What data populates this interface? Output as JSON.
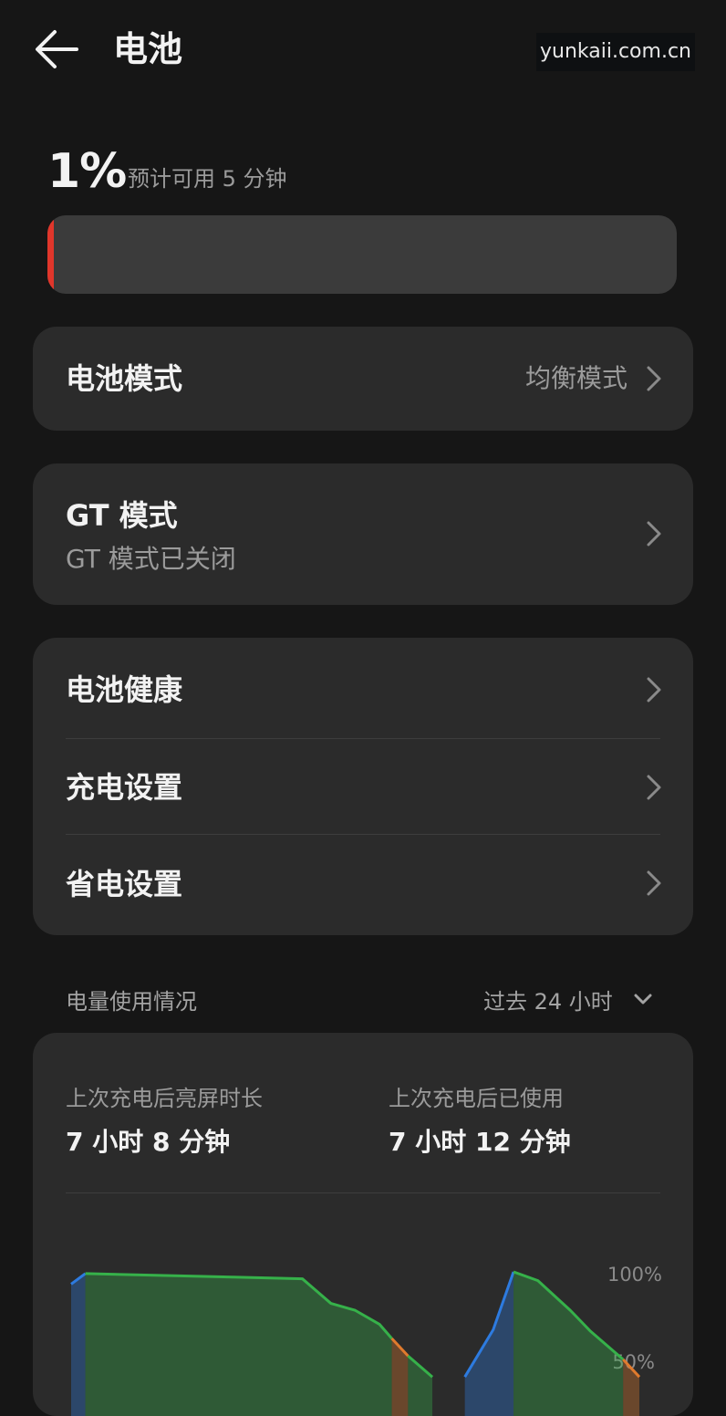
{
  "header": {
    "title": "电池",
    "watermark": "yunkaii.com.cn"
  },
  "battery": {
    "percent": "1%",
    "estimate": "预计可用 5 分钟",
    "level_fraction": 0.01,
    "level_color": "#e0362b"
  },
  "battery_mode": {
    "label": "电池模式",
    "value": "均衡模式"
  },
  "gt_mode": {
    "label": "GT 模式",
    "status": "GT 模式已关闭"
  },
  "settings": [
    {
      "label": "电池健康"
    },
    {
      "label": "充电设置"
    },
    {
      "label": "省电设置"
    }
  ],
  "usage": {
    "title": "电量使用情况",
    "range": "过去 24 小时",
    "stats": [
      {
        "label": "上次充电后亮屏时长",
        "value": "7 小时 8 分钟"
      },
      {
        "label": "上次充电后已使用",
        "value": "7 小时 12 分钟"
      }
    ]
  },
  "chart_data": {
    "type": "area",
    "y_tick_labels": [
      "100%",
      "50%"
    ],
    "ylim": [
      0,
      100
    ],
    "colors": {
      "discharge": "#36b14a",
      "charge": "#2d7be0",
      "warn": "#e07a2d"
    },
    "segments": [
      {
        "kind": "charge",
        "points": [
          [
            0,
            93
          ],
          [
            0.35,
            99
          ]
        ]
      },
      {
        "kind": "discharge",
        "points": [
          [
            0.35,
            99
          ],
          [
            4.0,
            97
          ],
          [
            5.7,
            96
          ],
          [
            5.9,
            92
          ],
          [
            6.4,
            82
          ],
          [
            7.0,
            78
          ],
          [
            7.6,
            70
          ],
          [
            7.9,
            62
          ]
        ]
      },
      {
        "kind": "warn",
        "points": [
          [
            7.9,
            62
          ],
          [
            8.3,
            52
          ]
        ]
      },
      {
        "kind": "discharge",
        "points": [
          [
            8.3,
            52
          ],
          [
            8.9,
            40
          ]
        ]
      },
      {
        "kind": "charge",
        "points": [
          [
            9.7,
            40
          ],
          [
            10.4,
            67
          ],
          [
            10.9,
            100
          ]
        ]
      },
      {
        "kind": "discharge",
        "points": [
          [
            10.9,
            100
          ],
          [
            11.5,
            95
          ],
          [
            12.3,
            78
          ],
          [
            12.8,
            66
          ],
          [
            13.6,
            50
          ]
        ]
      },
      {
        "kind": "warn",
        "points": [
          [
            13.6,
            50
          ],
          [
            14.0,
            40
          ]
        ]
      }
    ]
  }
}
